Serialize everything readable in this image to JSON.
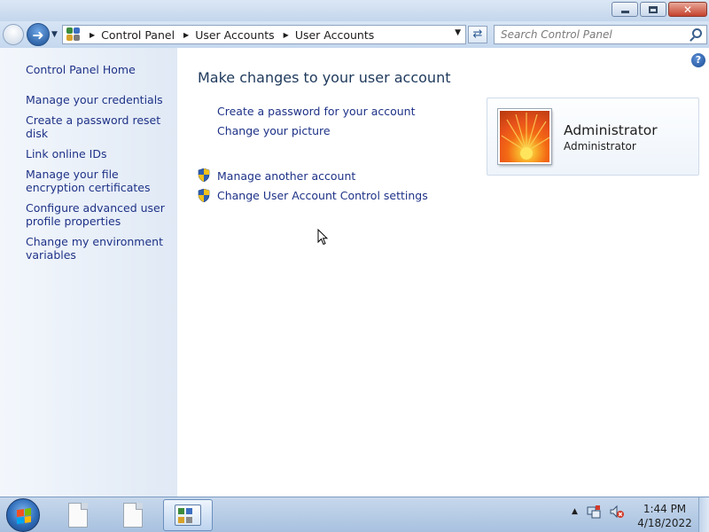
{
  "window": {
    "title_buttons": {
      "minimize": "minimize",
      "maximize": "maximize",
      "close": "✕"
    }
  },
  "navigation": {
    "back_icon": "back-arrow-icon",
    "forward_icon": "forward-arrow-icon",
    "breadcrumb": [
      "Control Panel",
      "User Accounts",
      "User Accounts"
    ],
    "search_placeholder": "Search Control Panel"
  },
  "sidebar": {
    "home": "Control Panel Home",
    "items": [
      "Manage your credentials",
      "Create a password reset disk",
      "Link online IDs",
      "Manage your file encryption certificates",
      "Configure advanced user profile properties",
      "Change my environment variables"
    ]
  },
  "main": {
    "heading": "Make changes to your user account",
    "links": [
      "Create a password for your account",
      "Change your picture"
    ],
    "shield_links": [
      "Manage another account",
      "Change User Account Control settings"
    ],
    "help_label": "?"
  },
  "account": {
    "name": "Administrator",
    "type": "Administrator"
  },
  "taskbar": {
    "clock_time": "1:44 PM",
    "clock_date": "4/18/2022"
  },
  "colors": {
    "link": "#1e3287",
    "heading": "#1e395b",
    "sidebar_bg": "#e6eef8",
    "taskbar_bg": "#b8cde6"
  }
}
